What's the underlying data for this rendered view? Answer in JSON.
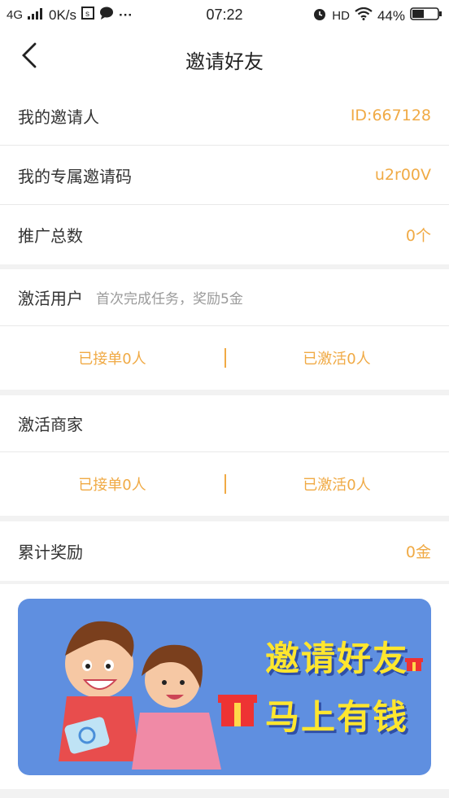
{
  "status_bar": {
    "network": "4G",
    "speed": "0K/s",
    "more": "···",
    "time": "07:22",
    "hd": "HD",
    "battery": "44%"
  },
  "nav": {
    "title": "邀请好友"
  },
  "info": {
    "inviter_label": "我的邀请人",
    "inviter_value": "ID:667128",
    "code_label": "我的专属邀请码",
    "code_value": "u2r00V",
    "total_label": "推广总数",
    "total_value": "0个"
  },
  "active_users": {
    "title": "激活用户",
    "subtitle": "首次完成任务，奖励5金",
    "accepted": "已接单0人",
    "activated": "已激活0人"
  },
  "active_merchants": {
    "title": "激活商家",
    "accepted": "已接单0人",
    "activated": "已激活0人"
  },
  "rewards": {
    "label": "累计奖励",
    "value": "0金"
  },
  "banner": {
    "line1": "邀请好友",
    "line2": "马上有钱"
  },
  "colors": {
    "accent": "#f0aa45",
    "banner_bg": "#5f8fe0",
    "banner_text": "#ffe62e"
  }
}
